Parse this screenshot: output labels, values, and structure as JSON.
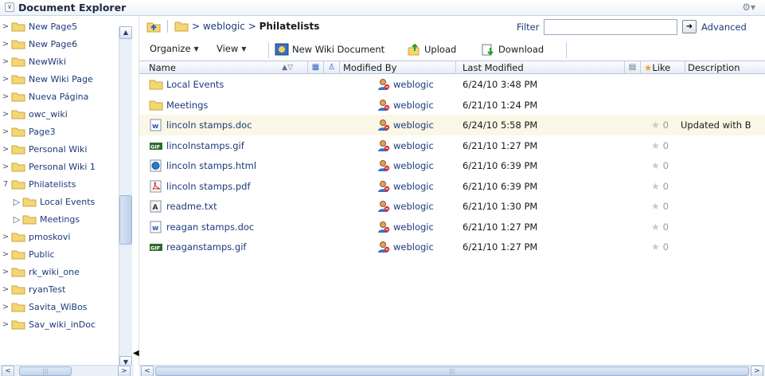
{
  "window": {
    "title": "Document Explorer",
    "collapse_glyph": "∨",
    "settings_glyph": "⚙▾"
  },
  "tree": {
    "items": [
      {
        "label": "New Page5",
        "expander": ">",
        "child": false
      },
      {
        "label": "New Page6",
        "expander": ">",
        "child": false
      },
      {
        "label": "NewWiki",
        "expander": ">",
        "child": false
      },
      {
        "label": "New Wiki Page",
        "expander": ">",
        "child": false
      },
      {
        "label": "Nueva Página",
        "expander": ">",
        "child": false
      },
      {
        "label": "owc_wiki",
        "expander": ">",
        "child": false
      },
      {
        "label": "Page3",
        "expander": ">",
        "child": false
      },
      {
        "label": "Personal Wiki",
        "expander": ">",
        "child": false
      },
      {
        "label": "Personal Wiki 1",
        "expander": ">",
        "child": false
      },
      {
        "label": "Philatelists",
        "expander": "7",
        "child": false
      },
      {
        "label": "Local Events",
        "expander": "▷",
        "child": true
      },
      {
        "label": "Meetings",
        "expander": "▷",
        "child": true
      },
      {
        "label": "pmoskovi",
        "expander": ">",
        "child": false
      },
      {
        "label": "Public",
        "expander": ">",
        "child": false
      },
      {
        "label": "rk_wiki_one",
        "expander": ">",
        "child": false
      },
      {
        "label": "ryanTest",
        "expander": ">",
        "child": false
      },
      {
        "label": "Savita_WiBos",
        "expander": ">",
        "child": false
      },
      {
        "label": "Sav_wiki_inDoc",
        "expander": ">",
        "child": false
      }
    ]
  },
  "breadcrumb": {
    "prefix": "> weblogic > ",
    "current": "Philatelists"
  },
  "filter": {
    "label": "Filter",
    "value": "",
    "placeholder": "",
    "advanced_label": "Advanced"
  },
  "toolbar": {
    "organize": "Organize",
    "view": "View",
    "new_wiki": "New Wiki Document",
    "upload": "Upload",
    "download": "Download"
  },
  "columns": {
    "name": "Name",
    "modified_by": "Modified By",
    "last_modified": "Last Modified",
    "like": "Like",
    "description": "Description"
  },
  "rows": [
    {
      "name": "Local Events",
      "type": "folder",
      "modified_by": "weblogic",
      "last_modified": "6/24/10 3:48 PM",
      "likes": "",
      "description": ""
    },
    {
      "name": "Meetings",
      "type": "folder",
      "modified_by": "weblogic",
      "last_modified": "6/21/10 1:24 PM",
      "likes": "",
      "description": ""
    },
    {
      "name": "lincoln stamps.doc",
      "type": "doc",
      "modified_by": "weblogic",
      "last_modified": "6/24/10 5:58 PM",
      "likes": "0",
      "description": "Updated with B"
    },
    {
      "name": "lincolnstamps.gif",
      "type": "gif",
      "modified_by": "weblogic",
      "last_modified": "6/21/10 1:27 PM",
      "likes": "0",
      "description": ""
    },
    {
      "name": "lincoln stamps.html",
      "type": "html",
      "modified_by": "weblogic",
      "last_modified": "6/21/10 6:39 PM",
      "likes": "0",
      "description": ""
    },
    {
      "name": "lincoln stamps.pdf",
      "type": "pdf",
      "modified_by": "weblogic",
      "last_modified": "6/21/10 6:39 PM",
      "likes": "0",
      "description": ""
    },
    {
      "name": "readme.txt",
      "type": "txt",
      "modified_by": "weblogic",
      "last_modified": "6/21/10 1:30 PM",
      "likes": "0",
      "description": ""
    },
    {
      "name": "reagan stamps.doc",
      "type": "doc",
      "modified_by": "weblogic",
      "last_modified": "6/21/10 1:27 PM",
      "likes": "0",
      "description": ""
    },
    {
      "name": "reaganstamps.gif",
      "type": "gif",
      "modified_by": "weblogic",
      "last_modified": "6/21/10 1:27 PM",
      "likes": "0",
      "description": ""
    }
  ],
  "selected_row": 2,
  "colors": {
    "link": "#1c3a7c",
    "folder_fill": "#f4d774",
    "folder_edge": "#c9a640",
    "selected_row_bg": "#fbf7e6"
  }
}
